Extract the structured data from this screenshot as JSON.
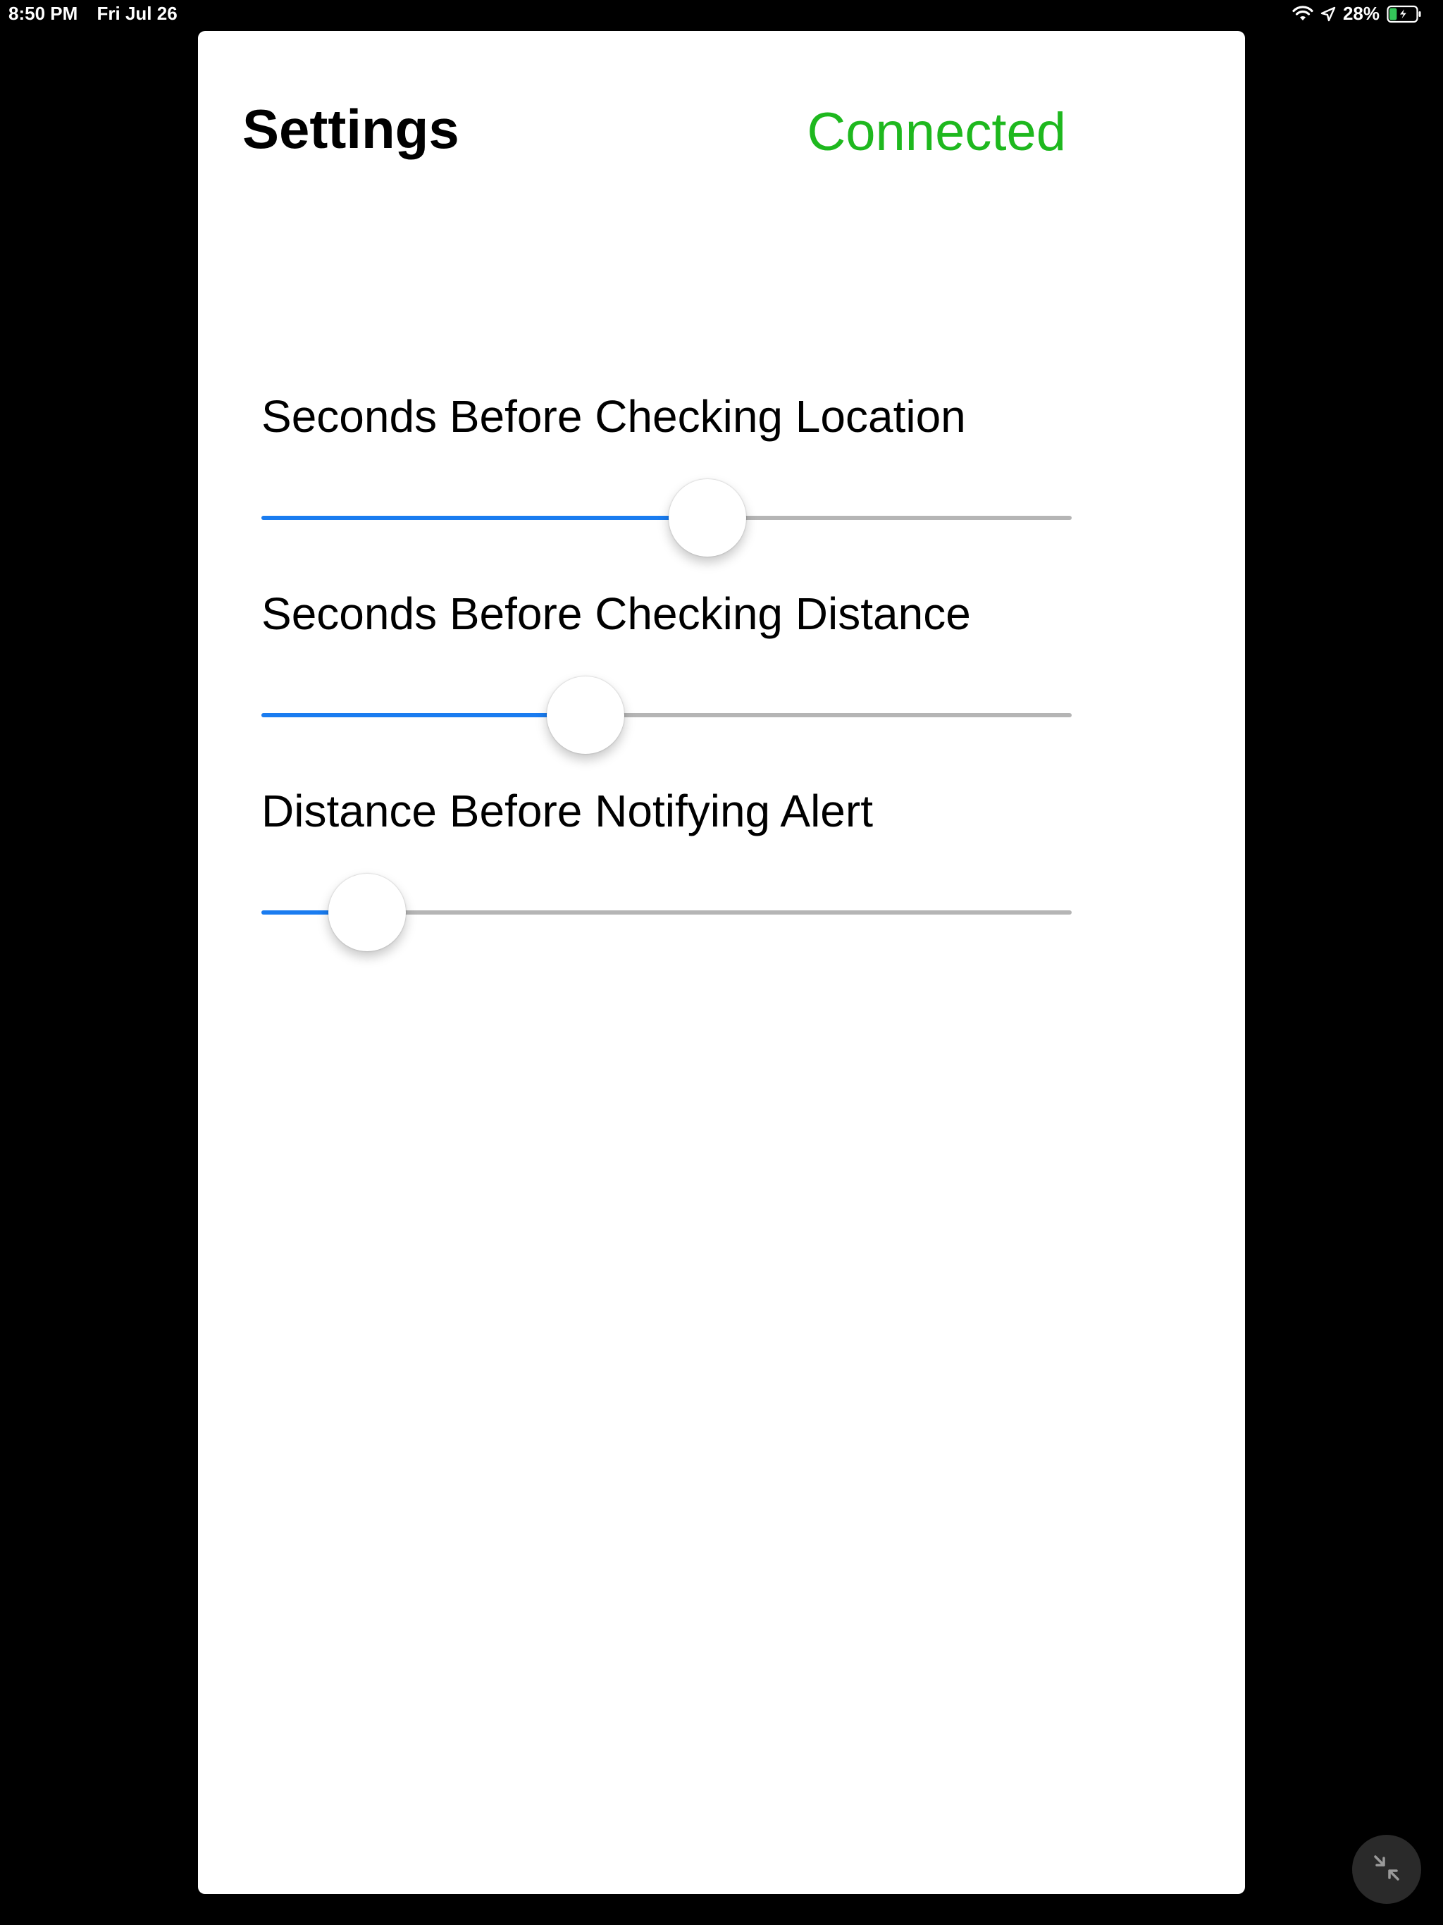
{
  "status_bar": {
    "time": "8:50 PM",
    "date": "Fri Jul 26",
    "battery_percent": "28%",
    "battery_level": 0.28,
    "charging": true
  },
  "header": {
    "title": "Settings",
    "connection_status": "Connected",
    "connection_color": "#1eb81e"
  },
  "settings": [
    {
      "label": "Seconds Before Checking Location",
      "value_fraction": 0.55
    },
    {
      "label": "Seconds Before Checking Distance",
      "value_fraction": 0.4
    },
    {
      "label": "Distance Before Notifying Alert",
      "value_fraction": 0.13
    }
  ],
  "colors": {
    "accent": "#1a7cf0",
    "track": "#b5b5b5"
  },
  "icons": {
    "minimize": "arrows-in-icon"
  }
}
